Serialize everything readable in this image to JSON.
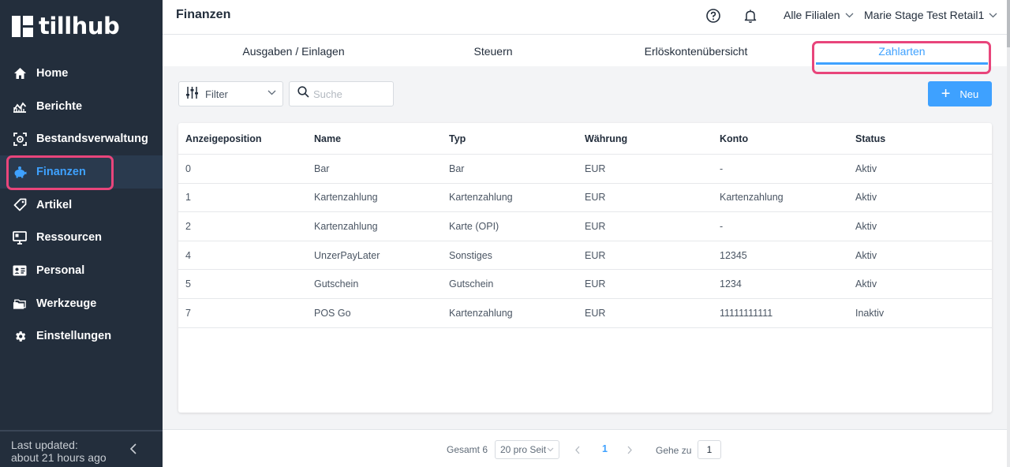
{
  "app": {
    "logo_text": "tillhub"
  },
  "sidebar": {
    "items": [
      {
        "label": "Home",
        "icon": "home-icon"
      },
      {
        "label": "Berichte",
        "icon": "chart-icon"
      },
      {
        "label": "Bestandsverwaltung",
        "icon": "inventory-icon"
      },
      {
        "label": "Finanzen",
        "icon": "piggy-bank-icon",
        "active": true
      },
      {
        "label": "Artikel",
        "icon": "tag-icon"
      },
      {
        "label": "Ressourcen",
        "icon": "monitor-icon"
      },
      {
        "label": "Personal",
        "icon": "id-card-icon"
      },
      {
        "label": "Werkzeuge",
        "icon": "folder-icon"
      },
      {
        "label": "Einstellungen",
        "icon": "gear-icon"
      }
    ],
    "footer": {
      "line1": "Last updated:",
      "line2": "about 21 hours ago"
    }
  },
  "header": {
    "title": "Finanzen",
    "branch_select": "Alle Filialen",
    "account_select": "Marie Stage Test Retail1"
  },
  "tabs": [
    {
      "label": "Ausgaben / Einlagen"
    },
    {
      "label": "Steuern"
    },
    {
      "label": "Erlöskontenübersicht"
    },
    {
      "label": "Zahlarten",
      "active": true
    }
  ],
  "toolbar": {
    "filter_label": "Filter",
    "search_placeholder": "Suche",
    "new_button": "Neu"
  },
  "table": {
    "columns": [
      "Anzeigeposition",
      "Name",
      "Typ",
      "Währung",
      "Konto",
      "Status"
    ],
    "rows": [
      [
        "0",
        "Bar",
        "Bar",
        "EUR",
        "-",
        "Aktiv"
      ],
      [
        "1",
        "Kartenzahlung",
        "Kartenzahlung",
        "EUR",
        "Kartenzahlung",
        "Aktiv"
      ],
      [
        "2",
        "Kartenzahlung",
        "Karte (OPI)",
        "EUR",
        "-",
        "Aktiv"
      ],
      [
        "4",
        "UnzerPayLater",
        "Sonstiges",
        "EUR",
        "12345",
        "Aktiv"
      ],
      [
        "5",
        "Gutschein",
        "Gutschein",
        "EUR",
        "1234",
        "Aktiv"
      ],
      [
        "7",
        "POS Go",
        "Kartenzahlung",
        "EUR",
        "11111111111",
        "Inaktiv"
      ]
    ]
  },
  "pagination": {
    "total_label": "Gesamt 6",
    "page_size": "20 pro Seit",
    "current_page": "1",
    "goto_label": "Gehe zu",
    "goto_value": "1"
  },
  "colors": {
    "accent": "#3ea1ff",
    "sidebar_bg": "#232e3c",
    "highlight": "#e8457b"
  }
}
